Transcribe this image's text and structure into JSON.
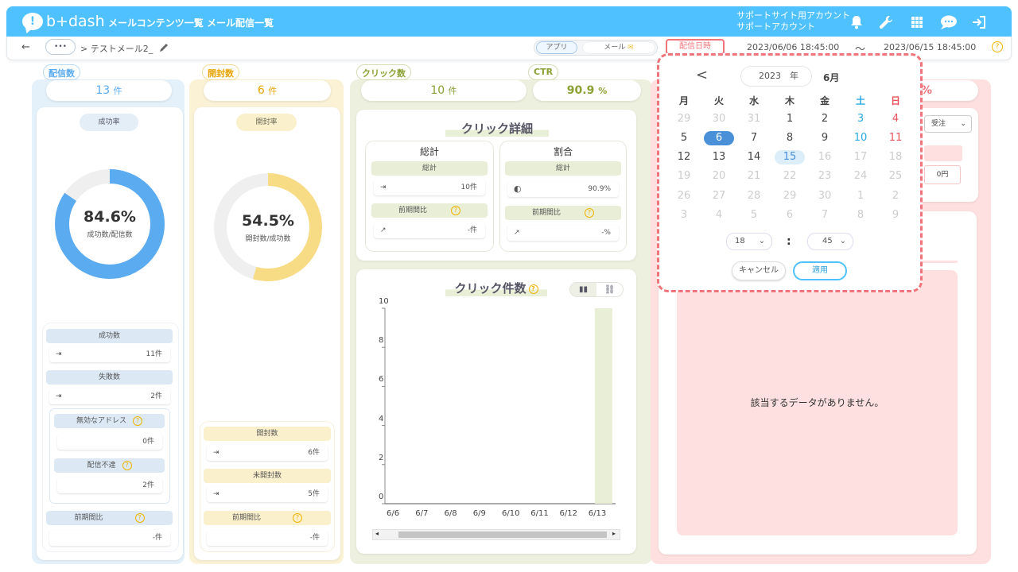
{
  "header": {
    "logo": "b+dash",
    "nav": [
      "メールコンテンツ一覧",
      "メール配信一覧"
    ],
    "account_line1": "サポートサイト用アカウント",
    "account_line2": "サポートアカウント",
    "icons": [
      "bell-icon",
      "wrench-icon",
      "grid-icon",
      "chat-icon",
      "logout-icon"
    ]
  },
  "subbar": {
    "back": "←",
    "more": "•••",
    "breadcrumb": "> テストメール2_",
    "toggle_app": "アプリ",
    "toggle_mail": "メール",
    "date_label": "配信日時",
    "date_from": "2023/06/06 18:45:00",
    "tilde": "〜",
    "date_to": "2023/06/15 18:45:00",
    "help": "?"
  },
  "col1": {
    "tag": "配信数",
    "value": "13",
    "unit": "件",
    "rate_label": "成功率",
    "rate_pct": "84.6%",
    "rate_sub": "成功数/配信数",
    "rate_value": 0.846,
    "color": "#5aabef",
    "success_label": "成功数",
    "success_val": "11件",
    "fail_label": "失敗数",
    "fail_val": "2件",
    "invalid_label": "無効なアドレス",
    "invalid_val": "0件",
    "undeliv_label": "配信不達",
    "undeliv_val": "2件",
    "prev_label": "前期間比",
    "prev_val": "-件"
  },
  "col2": {
    "tag": "開封数",
    "value": "6",
    "unit": "件",
    "rate_label": "開封率",
    "rate_pct": "54.5%",
    "rate_sub": "開封数/成功数",
    "rate_value": 0.545,
    "color": "#f7dc85",
    "open_label": "開封数",
    "open_val": "6件",
    "unopen_label": "未開封数",
    "unopen_val": "5件",
    "prev_label": "前期間比",
    "prev_val": "-件"
  },
  "col3": {
    "tag_click": "クリック数",
    "click_value": "10",
    "unit": "件",
    "tag_ctr": "CTR",
    "ctr_value": "90.9",
    "ctr_unit": "%",
    "detail_title": "クリック詳細",
    "total_title": "総計",
    "ratio_title": "割合",
    "total_label": "総計",
    "total_val": "10件",
    "ratio_total_label": "総計",
    "ratio_total_val": "90.9%",
    "prev_label": "前期間比",
    "prev_val": "-件",
    "ratio_prev_label": "前期間比",
    "ratio_prev_val": "-%",
    "chart_title": "クリック件数"
  },
  "col4": {
    "pct": "%",
    "dropdown": "受注",
    "amount": "0円",
    "empty": "該当するデータがありません。"
  },
  "calendar": {
    "prev": "<",
    "year": "2023",
    "year_unit": "年",
    "month": "6月",
    "weekdays": [
      "月",
      "火",
      "水",
      "木",
      "金",
      "土",
      "日"
    ],
    "weeks": [
      [
        "29",
        "30",
        "31",
        "1",
        "2",
        "3",
        "4"
      ],
      [
        "5",
        "6",
        "7",
        "8",
        "9",
        "10",
        "11"
      ],
      [
        "12",
        "13",
        "14",
        "15",
        "16",
        "17",
        "18"
      ],
      [
        "19",
        "20",
        "21",
        "22",
        "23",
        "24",
        "25"
      ],
      [
        "26",
        "27",
        "28",
        "29",
        "30",
        "1",
        "2"
      ],
      [
        "3",
        "4",
        "5",
        "6",
        "7",
        "8",
        "9"
      ]
    ],
    "selected": "6",
    "today": "15",
    "hour": "18",
    "colon": ":",
    "minute": "45",
    "cancel": "キャンセル",
    "apply": "適用"
  },
  "chart_data": {
    "type": "bar",
    "categories": [
      "6/6",
      "6/7",
      "6/8",
      "6/9",
      "6/10",
      "6/11",
      "6/12",
      "6/13"
    ],
    "values": [
      0,
      0,
      0,
      0,
      0,
      0,
      0,
      10
    ],
    "ylim": [
      0,
      10
    ],
    "yticks": [
      "0",
      "2",
      "4",
      "6",
      "8",
      "10"
    ],
    "title": "クリック件数",
    "color": "#e9eed6"
  }
}
